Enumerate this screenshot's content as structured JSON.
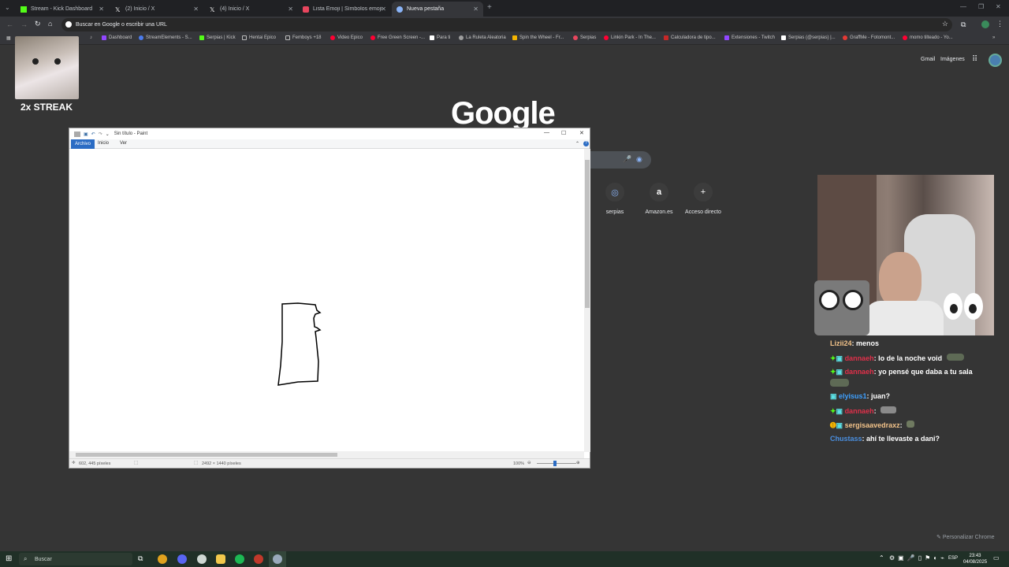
{
  "tabs": [
    {
      "label": "Stream - Kick Dashboard",
      "color": "#53fc18",
      "active": false
    },
    {
      "label": "(2) Inicio / X",
      "color": "#ffffff",
      "active": false
    },
    {
      "label": "(4) Inicio / X",
      "color": "#ffffff",
      "active": false
    },
    {
      "label": "Lista Emoji | Símbolos emoji ...",
      "color": "#e8465e",
      "active": false
    },
    {
      "label": "Nueva pestaña",
      "color": "#8ab4f8",
      "active": true
    }
  ],
  "omnibox": {
    "placeholder": "Buscar en Google o escribir una URL"
  },
  "bookmarks": [
    {
      "label": "Dashboard",
      "color": "#9146ff"
    },
    {
      "label": "StreamElements - S...",
      "color": "#4b7bec"
    },
    {
      "label": "Serpias | Kick",
      "color": "#53fc18"
    },
    {
      "label": "Hentai Epico",
      "color": "#bdbdbd"
    },
    {
      "label": "Femboys +18",
      "color": "#bdbdbd"
    },
    {
      "label": "Video Epico",
      "color": "#ff0033"
    },
    {
      "label": "Free Green Screen -...",
      "color": "#ff0033"
    },
    {
      "label": "Para ti",
      "color": "#ffffff"
    },
    {
      "label": "La Ruleta Aleatoria",
      "color": "#9e9e9e"
    },
    {
      "label": "Spin the Wheel - Fr...",
      "color": "#f4b400"
    },
    {
      "label": "Serpias",
      "color": "#e8465e"
    },
    {
      "label": "Linkin Park - In The...",
      "color": "#ff0033"
    },
    {
      "label": "Calculadora de tipo...",
      "color": "#c62828"
    },
    {
      "label": "Extensiones - Twitch",
      "color": "#9146ff"
    },
    {
      "label": "Serpias (@serpias) |...",
      "color": "#ffffff"
    },
    {
      "label": "GraffMe - Fotomont...",
      "color": "#e53935"
    },
    {
      "label": "momo tilteado - Yo...",
      "color": "#ff0033"
    }
  ],
  "overlay": {
    "streak": "2x STREAK"
  },
  "google": {
    "logo": "Google",
    "gmail": "Gmail",
    "images": "Imágenes",
    "shortcuts": [
      {
        "label": "serpias",
        "glyph": "◎"
      },
      {
        "label": "Amazon.es",
        "glyph": "a"
      },
      {
        "label": "Acceso directo",
        "glyph": "+"
      }
    ],
    "customize": "Personalizar Chrome"
  },
  "paint": {
    "title": "Sin título - Paint",
    "menu": [
      "Archivo",
      "Inicio",
      "Ver"
    ],
    "status_pos": "602, 445 píxeles",
    "status_size": "2492 × 1440 píxeles",
    "zoom": "100%"
  },
  "chat": [
    {
      "user": "Lizii24",
      "msg": ": menos",
      "color": "#f4c48a"
    },
    {
      "user": "dannaeh",
      "msg": ": lo de la noche void",
      "color": "#e0304a"
    },
    {
      "user": "dannaeh",
      "msg": ": yo pensé que daba a tu sala",
      "color": "#e0304a"
    },
    {
      "user": "elyisus1",
      "msg": ": juan?",
      "color": "#3ea0ff"
    },
    {
      "user": "dannaeh",
      "msg": ":",
      "color": "#e0304a"
    },
    {
      "user": "sergisaavedraxz",
      "msg": ":",
      "color": "#f4c48a"
    },
    {
      "user": "Chustass",
      "msg": ": ahí te llevaste a dani?",
      "color": "#4a8fe0"
    }
  ],
  "taskbar": {
    "search": "Buscar",
    "lang": "ESP",
    "time": "23:43",
    "date": "04/08/2025"
  }
}
